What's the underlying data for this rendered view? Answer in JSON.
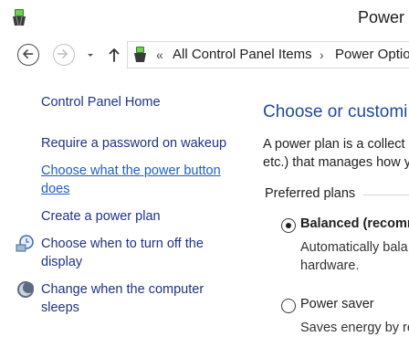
{
  "window": {
    "title": "Power"
  },
  "nav": {
    "back_icon": "back-arrow-icon",
    "forward_icon": "forward-arrow-icon",
    "dropdown_icon": "chevron-down-icon",
    "up_icon": "up-arrow-icon",
    "breadcrumb": {
      "overflow": "«",
      "items": [
        "All Control Panel Items",
        "Power Optio"
      ],
      "separator": "›"
    }
  },
  "sidebar": {
    "items": [
      {
        "label": "Control Panel Home"
      },
      {
        "label": "Require a password on wakeup"
      },
      {
        "label_line1": "Choose what the power button",
        "label_line2": "does"
      },
      {
        "label": "Create a power plan"
      },
      {
        "label_line1": "Choose when to turn off the",
        "label_line2": "display",
        "icon": "display-clock-icon"
      },
      {
        "label_line1": "Change when the computer",
        "label_line2": "sleeps",
        "icon": "moon-icon"
      }
    ]
  },
  "main": {
    "heading": "Choose or customi",
    "desc_line1": "A power plan is a collect",
    "desc_line2": "etc.) that manages how y",
    "preferred_plans_label": "Preferred plans",
    "plans": [
      {
        "label": "Balanced (recomm",
        "selected": true,
        "desc_line1": "Automatically bala",
        "desc_line2": "hardware."
      },
      {
        "label": "Power saver",
        "selected": false,
        "desc_line1": "Saves energy by re"
      }
    ]
  },
  "colors": {
    "link": "#1e3287",
    "heading": "#1e4a9a",
    "focused_link": "#1f5fbf"
  }
}
